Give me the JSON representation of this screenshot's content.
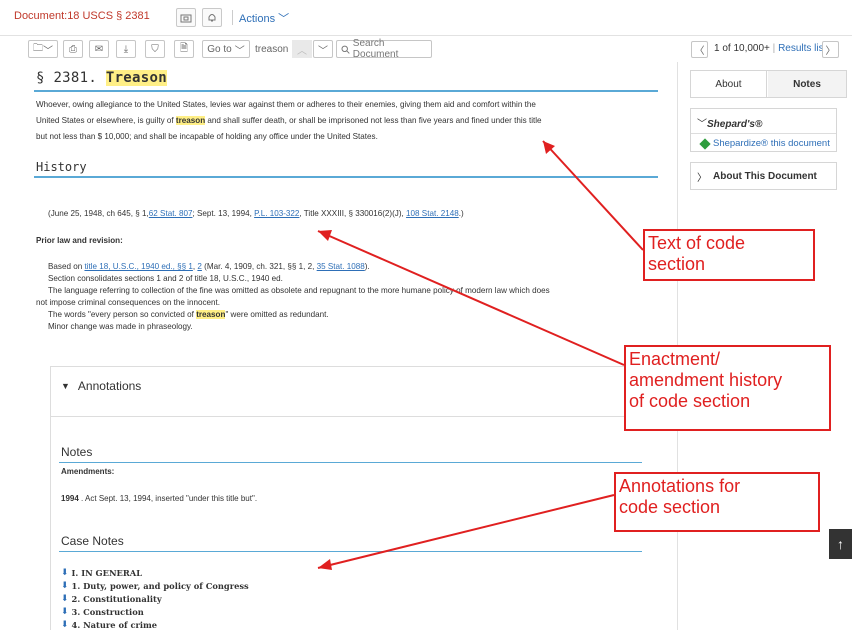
{
  "topbar": {
    "document_id": "Document:18 USCS § 2381",
    "actions_label": "Actions"
  },
  "toolbar": {
    "goto_label": "Go to",
    "search_term": "treason",
    "search_placeholder": "Search Document",
    "pager_text": "1 of 10,000+",
    "pager_separator": "|",
    "results_link": "Results list"
  },
  "document": {
    "section_number": "§ 2381.",
    "section_title": "Treason",
    "text_parts": [
      "Whoever, owing allegiance to the United States, levies war against them or adheres to their enemies, giving them aid and comfort within the",
      "United States or elsewhere, is guilty of ",
      "treason",
      " and shall suffer death, or shall be imprisoned not less than five years and fined under this title",
      "but not less than $ 10,000; and shall be incapable of holding any office under the United States."
    ],
    "history_heading": "History",
    "history_parts": {
      "a": "(June 25, 1948, ch 645, § 1,",
      "b": "62 Stat. 807",
      "c": "; Sept. 13, 1994,",
      "d": "P.L. 103-322",
      "e": ", Title XXXIII, § 330016(2)(J),",
      "f": "108 Stat. 2148",
      "g": ".)"
    },
    "prior_law_heading": "Prior law and revision:",
    "prior_parts": {
      "based_on": "Based on",
      "title_link": "title 18, U.S.C., 1940 ed., §§ 1",
      "comma": ",",
      "two_link": "2",
      "mid": "(Mar. 4, 1909, ch. 321, §§ 1, 2,",
      "stat_link": "35 Stat. 1088",
      "end": ").",
      "line2": "Section consolidates sections 1 and 2 of title 18, U.S.C., 1940 ed.",
      "line3": "The language referring to collection of the fine was omitted as obsolete and repugnant to the more humane policy of modern law which does",
      "line4": "not impose criminal consequences on the innocent.",
      "line5a": "The words \"every person so convicted of ",
      "line5b": "treason",
      "line5c": "\" were omitted as redundant.",
      "line6": "Minor change was made in phraseology."
    },
    "annotations_heading": "Annotations",
    "notes_heading": "Notes",
    "amendments_heading": "Amendments:",
    "amendment_year": "1994",
    "amendment_text": ". Act Sept. 13, 1994, inserted \"under this title but\".",
    "case_notes_heading": "Case Notes",
    "case_notes": [
      "I. IN GENERAL",
      "1. Duty, power, and policy of Congress",
      "2. Constitutionality",
      "3. Construction",
      "4. Nature of crime"
    ]
  },
  "sidebar": {
    "tab_about": "About",
    "tab_notes": "Notes",
    "shepards_heading": "Shepard's®",
    "shepardize_link": "Shepardize® this document",
    "about_document": "About This Document"
  },
  "callouts": {
    "text_of_section": "Text of code\nsection",
    "history": "Enactment/\namendment history\nof code section",
    "annotations": "Annotations for\ncode section"
  },
  "colors": {
    "callout": "#e02020",
    "link": "#2e6fb7",
    "highlight": "#ffef86",
    "rule": "#5aa9d6",
    "doc_id": "#c0392b"
  }
}
